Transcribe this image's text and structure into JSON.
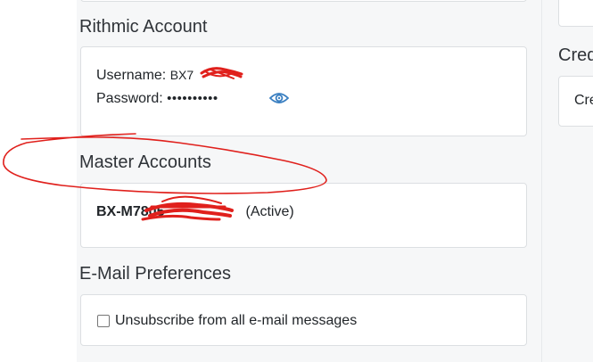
{
  "rithmic": {
    "heading": "Rithmic Account",
    "username_label": "Username:",
    "username_value": "BX7",
    "password_label": "Password:",
    "password_mask": "••••••••••"
  },
  "master_accounts": {
    "heading": "Master Accounts",
    "account_id": "BX-M7805",
    "status": "(Active)"
  },
  "email_prefs": {
    "heading": "E-Mail Preferences",
    "unsubscribe_label": "Unsubscribe from all e-mail messages",
    "unsubscribe_checked": false
  },
  "right_panel": {
    "heading_partial": "Cred",
    "item_partial": "Cre"
  },
  "annotation": {
    "ink_color": "#e0201c"
  },
  "colors": {
    "page_bg": "#f6f7f8",
    "card_border": "#dcdfe2",
    "eye_icon": "#3a7fc1"
  }
}
